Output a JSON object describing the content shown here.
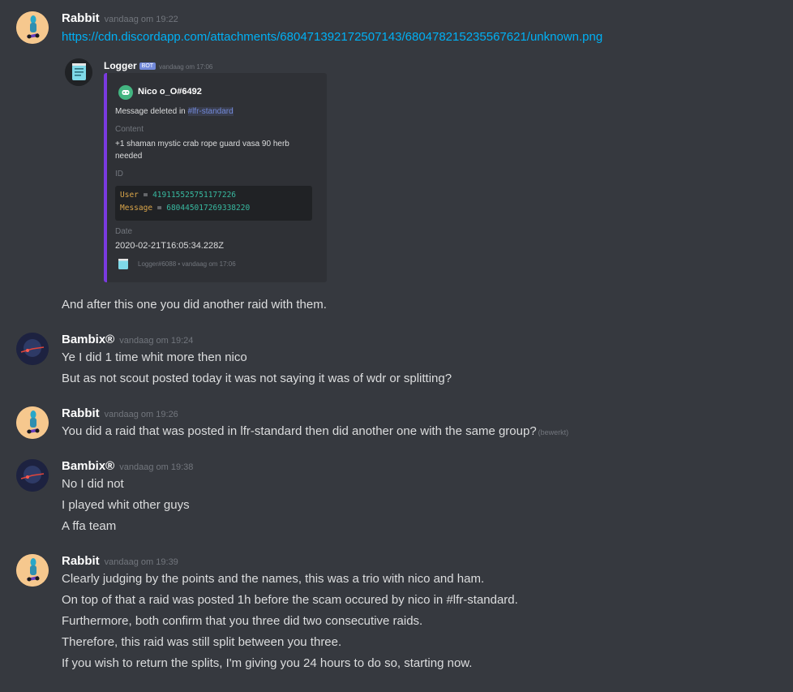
{
  "messages": [
    {
      "username": "Rabbit",
      "timestamp": "vandaag om 19:22",
      "link": "https://cdn.discordapp.com/attachments/680471392172507143/680478215235567621/unknown.png",
      "after_embed": "And after this one you did another raid with them."
    },
    {
      "username": "Bambix®",
      "timestamp": "vandaag om 19:24",
      "lines": [
        "Ye I did 1 time whit more then nico",
        "But as not scout posted today it was not saying it was of wdr or splitting?"
      ]
    },
    {
      "username": "Rabbit",
      "timestamp": "vandaag om 19:26",
      "text": "You did a raid that was posted in lfr-standard then did another one with the same group?",
      "edited": "(bewerkt)"
    },
    {
      "username": "Bambix®",
      "timestamp": "vandaag om 19:38",
      "lines": [
        "No I did not",
        "I played whit other guys",
        "A ffa team"
      ]
    },
    {
      "username": "Rabbit",
      "timestamp": "vandaag om 19:39",
      "lines": [
        "Clearly judging by the points and the names, this was a trio with nico and ham.",
        "On top of that a raid was posted 1h before the scam occured by nico in #lfr-standard.",
        "Furthermore, both confirm that you three did two consecutive raids.",
        "Therefore, this raid was still split between you three.",
        "If you wish to return the splits, I'm giving you 24 hours to do so, starting now."
      ]
    }
  ],
  "embed": {
    "bot_name": "Logger",
    "bot_tag": "BOT",
    "timestamp": "vandaag om 17:06",
    "author": "Nico o_O#6492",
    "desc_prefix": "Message deleted in ",
    "channel": "#lfr-standard",
    "content_label": "Content",
    "content_line1": "+1 shaman mystic crab rope guard vasa 90 herb",
    "content_line2": "needed",
    "id_label": "ID",
    "user_key": "User",
    "user_val": "419115525751177226",
    "message_key": "Message",
    "message_val": "680445017269338220",
    "date_label": "Date",
    "date_val": "2020-02-21T16:05:34.228Z",
    "footer": "Logger#6088 • vandaag om 17:06",
    "accent_color": "#7a3ae0"
  },
  "colors": {
    "background": "#36393f",
    "link": "#00b0f4",
    "username": "#ffffff",
    "timestamp": "#72767d"
  }
}
